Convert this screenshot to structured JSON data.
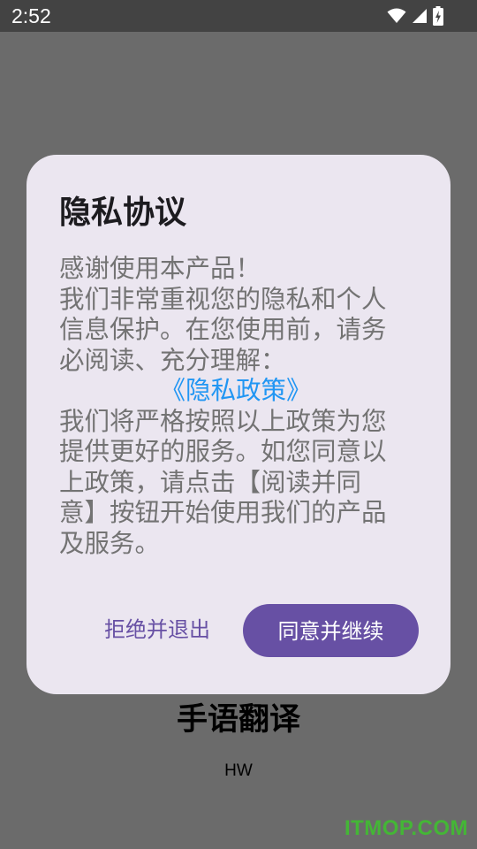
{
  "status_bar": {
    "time": "2:52",
    "icons": [
      "wifi-icon",
      "cellular-signal-icon",
      "battery-charging-icon"
    ]
  },
  "app": {
    "title": "手语翻译",
    "subtitle": "HW"
  },
  "dialog": {
    "title": "隐私协议",
    "body_lines_before": [
      "感谢使用本产品！",
      "我们非常重视您的隐私和个人",
      "信息保护。在您使用前，请务",
      "必阅读、充分理解："
    ],
    "policy_link": "《隐私政策》",
    "body_lines_after": [
      "我们将严格按照以上政策为您",
      "提供更好的服务。如您同意以",
      "上政策，请点击【阅读并同",
      "意】按钮开始使用我们的产品",
      "及服务。"
    ],
    "reject_label": "拒绝并退出",
    "agree_label": "同意并继续"
  },
  "watermark": "ITMOP.COM",
  "colors": {
    "scrim": "#6b6b6b",
    "status_bar": "#434343",
    "dialog_background": "#ebe6f0",
    "primary": "#6750a4",
    "link": "#2196f3",
    "body_text": "#737373",
    "watermark": "#44b636"
  }
}
